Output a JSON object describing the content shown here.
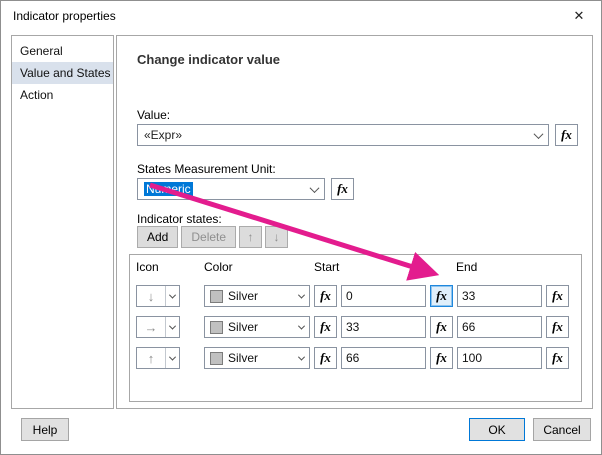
{
  "window": {
    "title": "Indicator properties"
  },
  "icons": {
    "close": "✕",
    "move_up": "↑",
    "move_down": "↓",
    "row_down_arrow": "↓",
    "row_right_arrow": "→",
    "row_up_arrow": "↑",
    "fx": "fx"
  },
  "sidebar": {
    "items": [
      {
        "label": "General"
      },
      {
        "label": "Value and States"
      },
      {
        "label": "Action"
      }
    ]
  },
  "panel": {
    "heading": "Change indicator value",
    "value_field": {
      "label": "Value:",
      "value": "«Expr»"
    },
    "unit_field": {
      "label": "States Measurement Unit:",
      "value": "Numeric"
    },
    "states": {
      "label": "Indicator states:",
      "add": "Add",
      "delete": "Delete",
      "table": {
        "headers": {
          "icon": "Icon",
          "color": "Color",
          "start": "Start",
          "end": "End"
        },
        "rows": [
          {
            "color": "Silver",
            "start": "0",
            "end": "33"
          },
          {
            "color": "Silver",
            "start": "33",
            "end": "66"
          },
          {
            "color": "Silver",
            "start": "66",
            "end": "100"
          }
        ]
      }
    }
  },
  "footer": {
    "help": "Help",
    "ok": "OK",
    "cancel": "Cancel"
  },
  "colors": {
    "accent": "#0078d7",
    "selection_bg": "#0078d7",
    "annotation": "#e31c8e",
    "silver": "#c0c0c0"
  }
}
